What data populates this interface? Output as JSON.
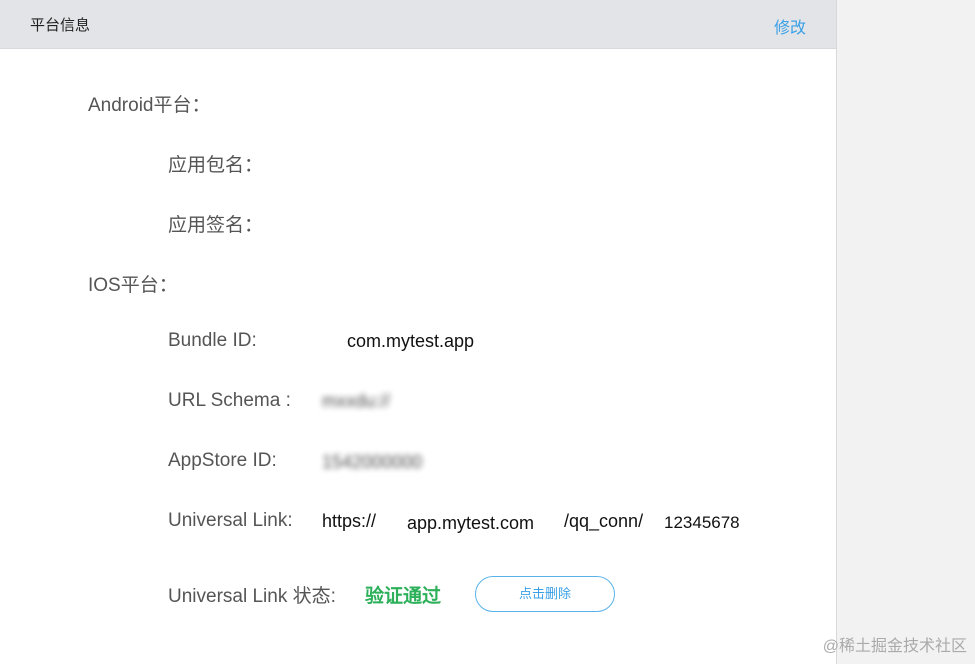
{
  "header": {
    "title": "平台信息",
    "edit_label": "修改"
  },
  "android": {
    "section_label": "Android平台：",
    "package_label": "应用包名：",
    "signature_label": "应用签名："
  },
  "ios": {
    "section_label": "IOS平台：",
    "bundle_label": "Bundle ID:",
    "bundle_value": "com.mytest.app",
    "url_schema_label": "URL Schema :",
    "url_schema_value": "mxxdu://",
    "appstore_label": "AppStore ID:",
    "appstore_value": "1542000000",
    "universal_link_label": "Universal Link:",
    "universal_link_part1": "https://",
    "universal_link_part2": "app.mytest.com",
    "universal_link_part3": "/qq_conn/",
    "universal_link_part4": "12345678",
    "ul_status_label": "Universal Link 状态:",
    "ul_status_value": "验证通过",
    "delete_button_label": "点击删除"
  },
  "watermark": "@稀土掘金技术社区",
  "colors": {
    "accent": "#3aa0e6",
    "success": "#2db05a",
    "header_bg": "#e3e4e8"
  }
}
